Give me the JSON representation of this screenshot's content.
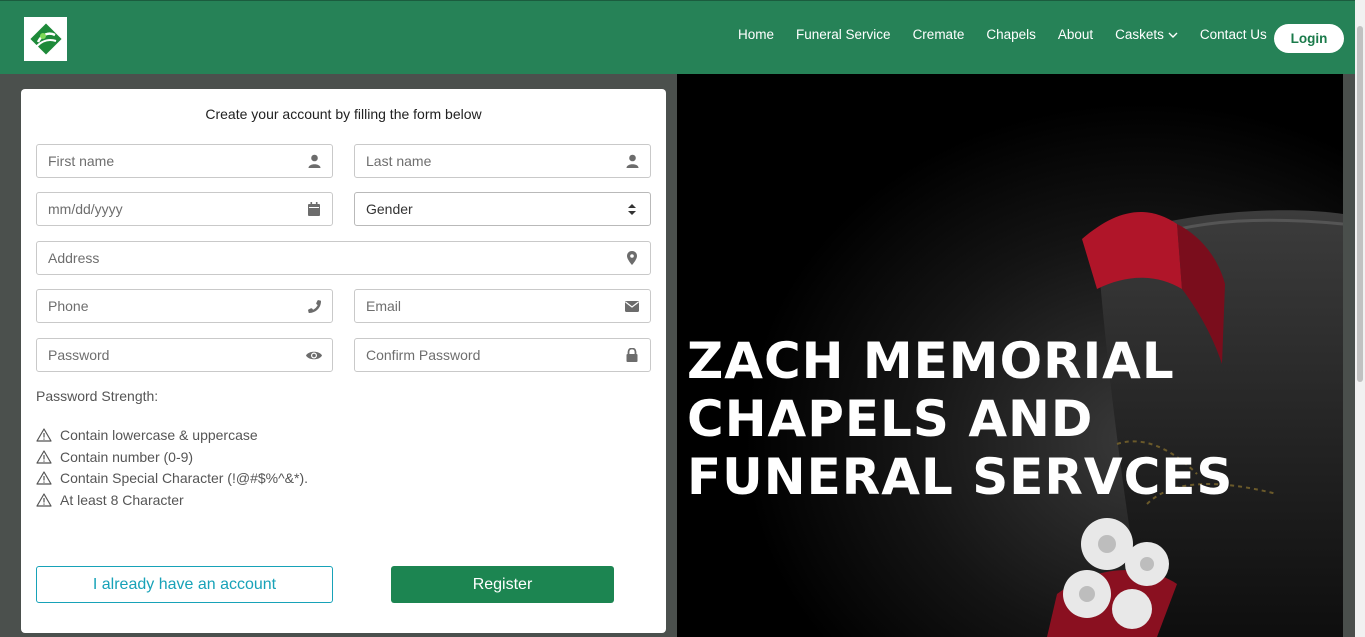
{
  "nav": {
    "links": [
      "Home",
      "Funeral Service",
      "Cremate",
      "Chapels",
      "About",
      "Caskets",
      "Contact Us"
    ],
    "login_label": "Login"
  },
  "form": {
    "title": "Create your account by filling the form below",
    "first_name_placeholder": "First name",
    "last_name_placeholder": "Last name",
    "date_placeholder": "mm/dd/yyyy",
    "gender_value": "Gender",
    "address_placeholder": "Address",
    "phone_placeholder": "Phone",
    "email_placeholder": "Email",
    "password_placeholder": "Password",
    "confirm_password_placeholder": "Confirm Password",
    "strength_title": "Password Strength:",
    "rules": [
      "Contain lowercase & uppercase",
      "Contain number (0-9)",
      "Contain Special Character (!@#$%^&*).",
      "At least 8 Character"
    ],
    "have_account_label": "I already have an account",
    "register_label": "Register"
  },
  "hero": {
    "title": "ZACH MEMORIAL\nCHAPELS AND\nFUNERAL SERVCES"
  },
  "colors": {
    "brand_green": "#268257",
    "register_green": "#1c8551",
    "info_cyan": "#17a2b8",
    "casket_red": "#b01529"
  },
  "icons": [
    "logo-icon",
    "user-icon",
    "calendar-icon",
    "sort-icon",
    "map-marker-icon",
    "phone-icon",
    "envelope-icon",
    "eye-icon",
    "lock-icon",
    "warning-icon",
    "chevron-down-icon"
  ]
}
